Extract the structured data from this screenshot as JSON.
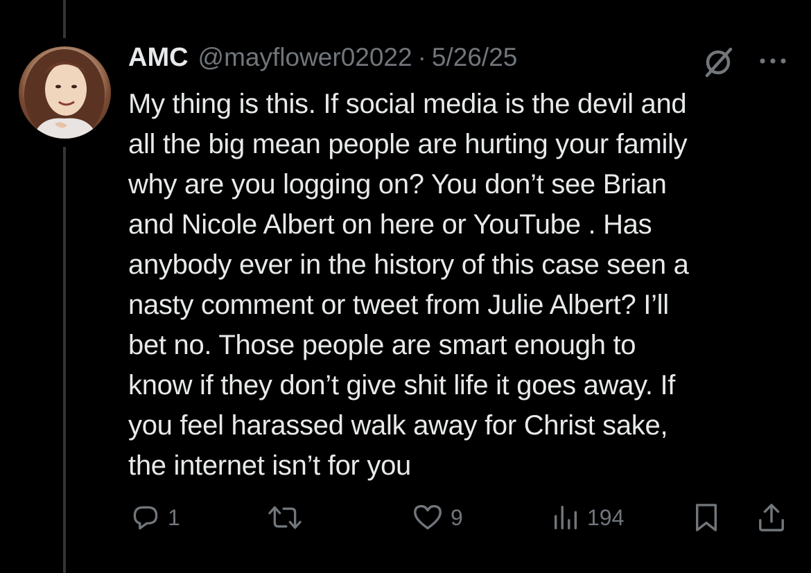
{
  "tweet": {
    "author": {
      "display_name": "AMC",
      "handle": "@mayflower02022"
    },
    "separator": "·",
    "date": "5/26/25",
    "text": "My thing is this. If social media is the devil and\nall the big mean people are hurting your family\nwhy are you logging on? You don’t see Brian\nand Nicole Albert on here or YouTube . Has\nanybody ever in the history of this case seen a\nnasty comment or tweet from Julie Albert? I’ll\nbet no. Those people are smart enough to\nknow if they don’t give shit life it goes away. If\nyou feel harassed walk away for Christ sake,\nthe internet isn’t for you",
    "actions": {
      "reply_count": "1",
      "retweet_count": "",
      "like_count": "9",
      "view_count": "194"
    }
  },
  "icons": {
    "grok": "grok-icon",
    "more": "more-icon",
    "reply": "reply-icon",
    "retweet": "retweet-icon",
    "like": "heart-icon",
    "views": "views-icon",
    "bookmark": "bookmark-icon",
    "share": "share-icon"
  },
  "colors": {
    "background": "#000000",
    "text_primary": "#e7e9ea",
    "text_secondary": "#71767b",
    "thread_line": "#333639"
  }
}
